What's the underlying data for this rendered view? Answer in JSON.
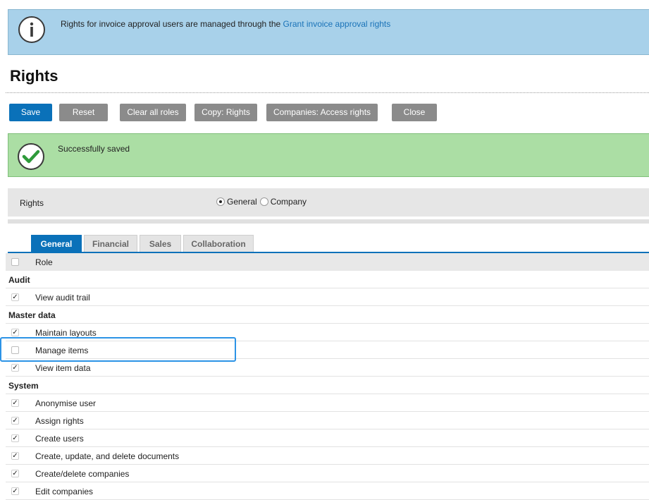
{
  "info_banner": {
    "text": "Rights for invoice approval users are managed through the ",
    "link": "Grant invoice approval rights"
  },
  "page_title": "Rights",
  "toolbar": {
    "save": "Save",
    "reset": "Reset",
    "clear_all_roles": "Clear all roles",
    "copy_rights": "Copy: Rights",
    "companies_access_rights": "Companies: Access rights",
    "close": "Close"
  },
  "success_banner": {
    "text": "Successfully saved"
  },
  "rights_panel": {
    "label": "Rights",
    "options": [
      {
        "label": "General",
        "selected": true
      },
      {
        "label": "Company",
        "selected": false
      }
    ]
  },
  "tabs": [
    {
      "label": "General",
      "active": true
    },
    {
      "label": "Financial",
      "active": false
    },
    {
      "label": "Sales",
      "active": false
    },
    {
      "label": "Collaboration",
      "active": false
    }
  ],
  "table": {
    "header": "Role",
    "groups": [
      {
        "name": "Audit",
        "rows": [
          {
            "label": "View audit trail",
            "checked": true
          }
        ]
      },
      {
        "name": "Master data",
        "rows": [
          {
            "label": "Maintain layouts",
            "checked": true
          },
          {
            "label": "Manage items",
            "checked": false
          },
          {
            "label": "View item data",
            "checked": true
          }
        ]
      },
      {
        "name": "System",
        "rows": [
          {
            "label": "Anonymise user",
            "checked": true
          },
          {
            "label": "Assign rights",
            "checked": true
          },
          {
            "label": "Create users",
            "checked": true
          },
          {
            "label": "Create, update, and delete documents",
            "checked": true
          },
          {
            "label": "Create/delete companies",
            "checked": true
          },
          {
            "label": "Edit companies",
            "checked": true
          }
        ]
      }
    ]
  },
  "colors": {
    "info_bg": "#a8d1ea",
    "success_bg": "#abdea4",
    "primary": "#0a71b9",
    "button_gray": "#8b8b8b",
    "highlight": "#2c93e6"
  },
  "icons": {
    "info": "info-icon",
    "success": "check-circle-icon"
  }
}
